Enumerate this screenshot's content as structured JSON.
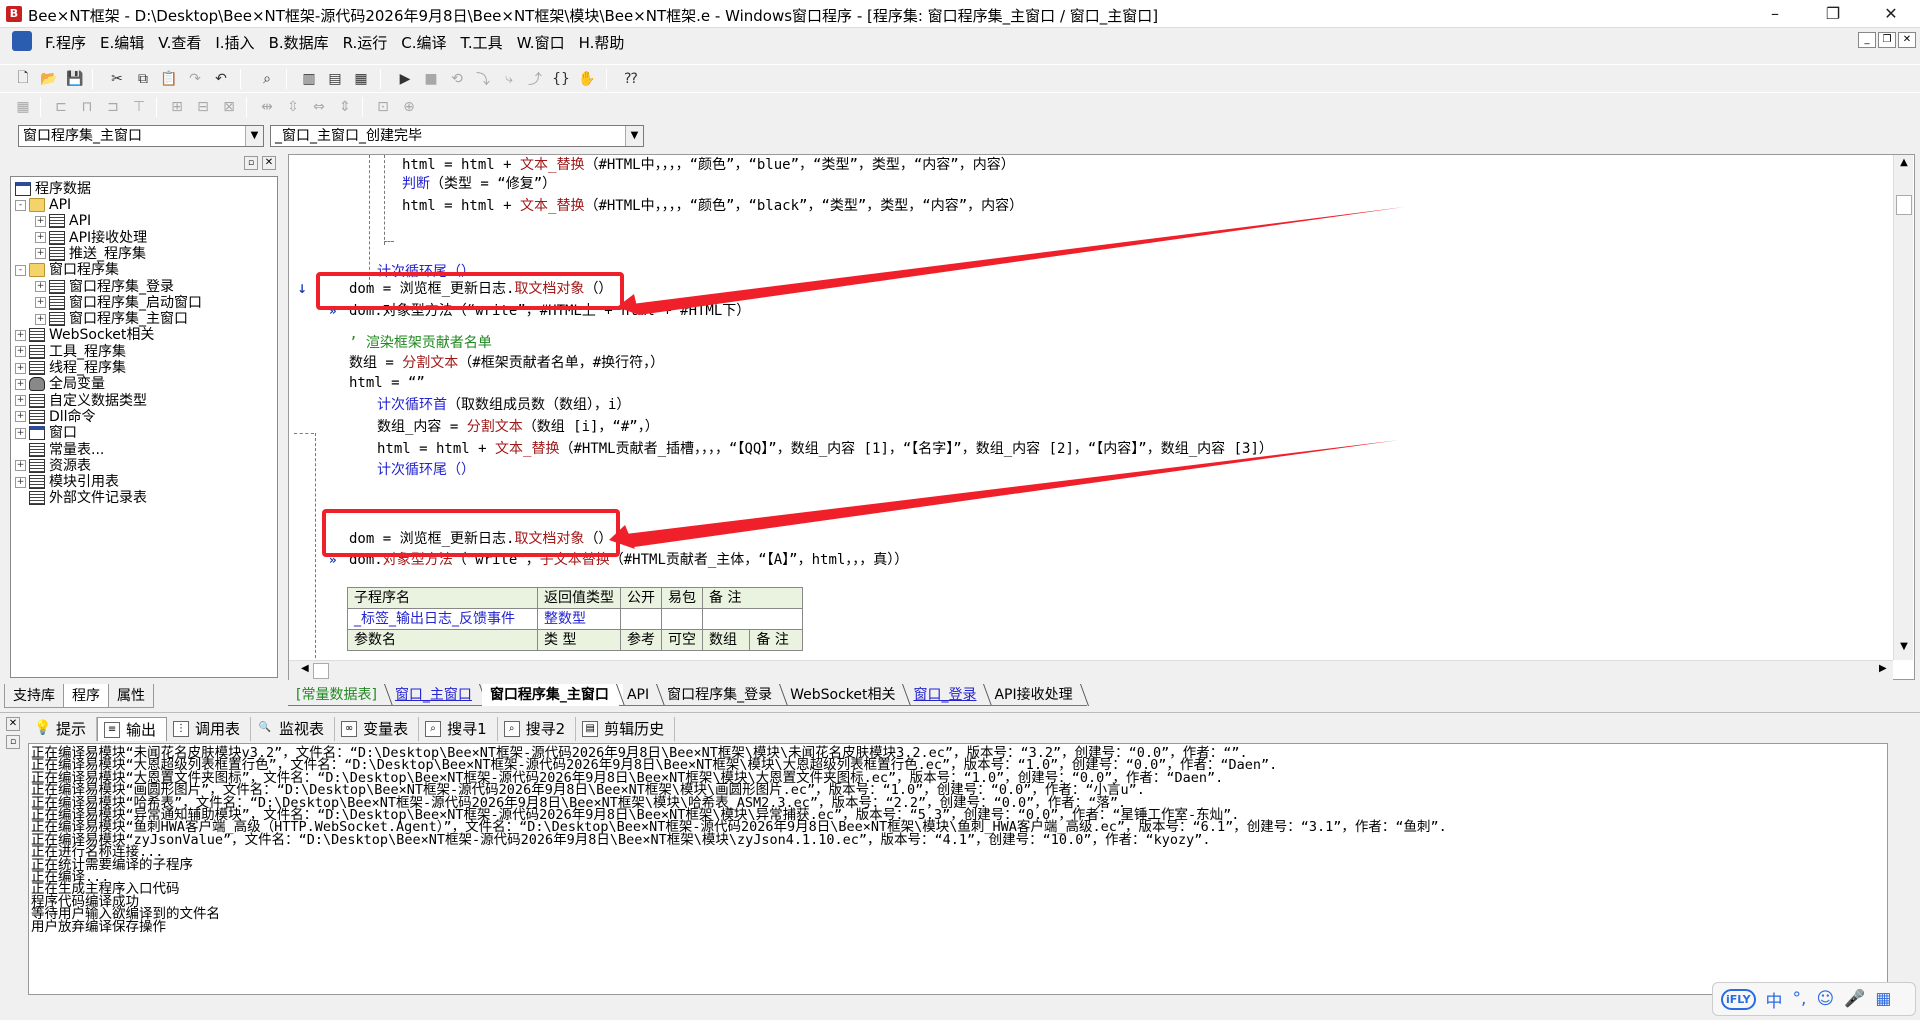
{
  "window": {
    "title": "Bee×NT框架 - D:\\Desktop\\Bee×NT框架-源代码2026年9月8日\\Bee×NT框架\\模块\\Bee×NT框架.e - Windows窗口程序 - [程序集: 窗口程序集_主窗口 / 窗口_主窗口]",
    "minimize": "–",
    "restore": "❐",
    "close": "✕"
  },
  "menu": {
    "items": [
      "F.程序",
      "E.编辑",
      "V.查看",
      "I.插入",
      "B.数据库",
      "R.运行",
      "C.编译",
      "T.工具",
      "W.窗口",
      "H.帮助"
    ],
    "mdi_minimize": "_",
    "mdi_restore": "❐",
    "mdi_close": "✕"
  },
  "combos": {
    "class_combo": "窗口程序集_主窗口",
    "method_combo": "_窗口_主窗口_创建完毕"
  },
  "tree": {
    "root": "程序数据",
    "nodes": [
      {
        "label": "API",
        "depth": 1,
        "exp": "-",
        "icon": "folder"
      },
      {
        "label": "API",
        "depth": 2,
        "exp": "+",
        "icon": "stack"
      },
      {
        "label": "API接收处理",
        "depth": 2,
        "exp": "+",
        "icon": "stack"
      },
      {
        "label": "推送_程序集",
        "depth": 2,
        "exp": "+",
        "icon": "stack"
      },
      {
        "label": "窗口程序集",
        "depth": 1,
        "exp": "-",
        "icon": "folder"
      },
      {
        "label": "窗口程序集_登录",
        "depth": 2,
        "exp": "+",
        "icon": "stack"
      },
      {
        "label": "窗口程序集_启动窗口",
        "depth": 2,
        "exp": "+",
        "icon": "stack"
      },
      {
        "label": "窗口程序集_主窗口",
        "depth": 2,
        "exp": "+",
        "icon": "stack"
      },
      {
        "label": "WebSocket相关",
        "depth": 1,
        "exp": "+",
        "icon": "stack"
      },
      {
        "label": "工具_程序集",
        "depth": 1,
        "exp": "+",
        "icon": "stack"
      },
      {
        "label": "线程_程序集",
        "depth": 1,
        "exp": "+",
        "icon": "stack"
      },
      {
        "label": "全局变量",
        "depth": 1,
        "exp": "+",
        "icon": "db"
      },
      {
        "label": "自定义数据类型",
        "depth": 1,
        "exp": "+",
        "icon": "stack"
      },
      {
        "label": "Dll命令",
        "depth": 1,
        "exp": "+",
        "icon": "stack"
      },
      {
        "label": "窗口",
        "depth": 1,
        "exp": "+",
        "icon": "win"
      },
      {
        "label": "常量表...",
        "depth": 1,
        "exp": "",
        "icon": "stack"
      },
      {
        "label": "资源表",
        "depth": 1,
        "exp": "+",
        "icon": "stack"
      },
      {
        "label": "模块引用表",
        "depth": 1,
        "exp": "+",
        "icon": "stack"
      },
      {
        "label": "外部文件记录表",
        "depth": 1,
        "exp": "",
        "icon": "stack"
      }
    ],
    "tabs": [
      "支持库",
      "程序",
      "属性"
    ]
  },
  "code": {
    "l1": {
      "a": "html = html + ",
      "f": "文本_替换",
      "b": "（#HTML中，，，，“颜色”，“blue”，“类型”，类型，“内容”，内容）"
    },
    "l2": {
      "kw": "判断",
      "b": "（类型 = “修复”）"
    },
    "l3": {
      "a": "html = html + ",
      "f": "文本_替换",
      "b": "（#HTML中，，，，“颜色”，“black”，“类型”，类型，“内容”，内容）"
    },
    "l4": "计次循环尾（）",
    "l5": {
      "a": "dom = 浏览框_更新日志.",
      "f": "取文档对象",
      "b": "（）"
    },
    "l6": "dom.对象型方法（“write”，#HTML上 + html + #HTML下）",
    "l7": "’ 渲染框架贡献者名单",
    "l8": {
      "a": "数组 = ",
      "f": "分割文本",
      "b": "（#框架贡献者名单，#换行符，）"
    },
    "l9": "html = “”",
    "l10": {
      "kw": "计次循环首",
      "b": "（取数组成员数（数组），i）"
    },
    "l11": {
      "a": "数组_内容 = ",
      "f": "分割文本",
      "b": "（数组 [i]，“#”，）"
    },
    "l12": {
      "a": "html = html + ",
      "f": "文本_替换",
      "b": "（#HTML贡献者_插槽，，，，“【QQ】”，数组_内容 [1]，“【名字】”，数组_内容 [2]，“【内容】”，数组_内容 [3]）"
    },
    "l13": "计次循环尾（）",
    "l14": {
      "a": "dom = 浏览框_更新日志.",
      "f": "取文档对象",
      "b": "（）"
    },
    "l15": {
      "a": "dom.",
      "f": "对象型方法",
      "b": "（“write”，",
      "f2": "子文本替换",
      "c": "（#HTML贡献者_主体，“【A】”，html，，，真））"
    },
    "table": {
      "h1": [
        "子程序名",
        "返回值类型",
        "公开",
        "易包",
        "备 注"
      ],
      "r1": [
        "_标签_输出日志_反馈事件",
        "整数型",
        "",
        "",
        ""
      ],
      "h2": [
        "参数名",
        "类 型",
        "参考",
        "可空",
        "数组",
        "备 注"
      ]
    }
  },
  "doc_tabs": [
    "[常量数据表]",
    "窗口_主窗口",
    "窗口程序集_主窗口",
    "API",
    "窗口程序集_登录",
    "WebSocket相关",
    "窗口_登录",
    "API接收处理"
  ],
  "output_tabs": [
    "提示",
    "输出",
    "调用表",
    "监视表",
    "变量表",
    "搜寻1",
    "搜寻2",
    "剪辑历史"
  ],
  "output_lines": [
    "正在编译易模块“未闻花名皮肤模块v3.2”，文件名：“D:\\Desktop\\Bee×NT框架-源代码2026年9月8日\\Bee×NT框架\\模块\\未闻花名皮肤模块3.2.ec”，版本号：“3.2”，创建号：“0.0”，作者：“”.",
    "正在编译易模块“大恩超级列表框置行色”，文件名：“D:\\Desktop\\Bee×NT框架-源代码2026年9月8日\\Bee×NT框架\\模块\\大恩超级列表框置行色.ec”，版本号：“1.0”，创建号：“0.0”，作者：“Daen”.",
    "正在编译易模块“大恩置文件夹图标”，文件名：“D:\\Desktop\\Bee×NT框架-源代码2026年9月8日\\Bee×NT框架\\模块\\大恩置文件夹图标.ec”，版本号：“1.0”，创建号：“0.0”，作者：“Daen”.",
    "正在编译易模块“画圆形图片”，文件名：“D:\\Desktop\\Bee×NT框架-源代码2026年9月8日\\Bee×NT框架\\模块\\画圆形图片.ec”，版本号：“1.0”，创建号：“0.0”，作者：“小言u”.",
    "正在编译易模块“哈希表”，文件名：“D:\\Desktop\\Bee×NT框架-源代码2026年9月8日\\Bee×NT框架\\模块\\哈希表_ASM2.3.ec”，版本号：“2.2”，创建号：“0.0”，作者：“落”.",
    "正在编译易模块“异常通知辅助模块”，文件名：“D:\\Desktop\\Bee×NT框架-源代码2026年9月8日\\Bee×NT框架\\模块\\异常捕获.ec”，版本号：“5.3”，创建号：“0.0”，作者：“星锤工作室-东灿”.",
    "正在编译易模块“鱼刺HWA客户端_高级（HTTP.WebSocket.Agent）”，文件名：“D:\\Desktop\\Bee×NT框架-源代码2026年9月8日\\Bee×NT框架\\模块\\鱼刺_HWA客户端_高级.ec”，版本号：“6.1”，创建号：“3.1”，作者：“鱼刺”.",
    "正在编译易模块“zyJsonValue”，文件名：“D:\\Desktop\\Bee×NT框架-源代码2026年9月8日\\Bee×NT框架\\模块\\zyJson4.1.10.ec”，版本号：“4.1”，创建号：“10.0”，作者：“kyozy”.",
    "正在进行名称连接...",
    "正在统计需要编译的子程序",
    "正在编译...",
    "正在生成主程序入口代码",
    "程序代码编译成功",
    "等待用户输入欲编译到的文件名",
    "用户放弃编译保存操作"
  ],
  "ime": {
    "logo": "iFLY",
    "lang": "中",
    "punct": "°,",
    "emoji": "☺",
    "mic": "🎤",
    "grid": "▦"
  }
}
